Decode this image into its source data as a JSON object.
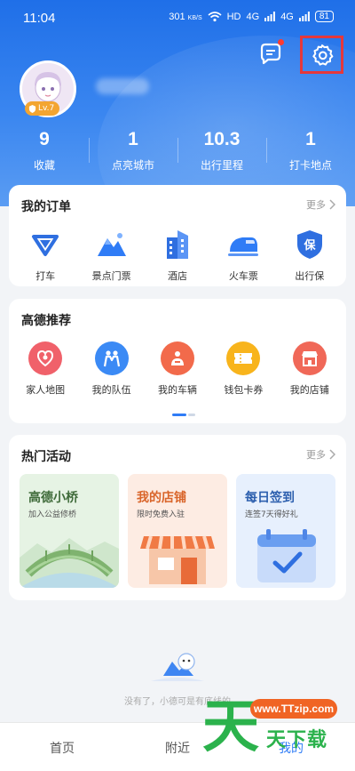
{
  "status_bar": {
    "time": "11:04",
    "net_speed": "301",
    "net_unit": "KB/S",
    "hd": "HD",
    "signal_1": "4G",
    "signal_2": "4G",
    "battery": "81"
  },
  "profile": {
    "level": "Lv.7"
  },
  "stats": [
    {
      "value": "9",
      "label": "收藏"
    },
    {
      "value": "1",
      "label": "点亮城市"
    },
    {
      "value": "10.3",
      "label": "出行里程"
    },
    {
      "value": "1",
      "label": "打卡地点"
    }
  ],
  "orders": {
    "title": "我的订单",
    "more": "更多",
    "items": [
      {
        "label": "打车",
        "icon": "taxi-icon"
      },
      {
        "label": "景点门票",
        "icon": "mountain-icon"
      },
      {
        "label": "酒店",
        "icon": "hotel-icon"
      },
      {
        "label": "火车票",
        "icon": "train-icon"
      },
      {
        "label": "出行保",
        "icon": "insurance-icon"
      }
    ]
  },
  "recommend": {
    "title": "高德推荐",
    "items": [
      {
        "label": "家人地图",
        "icon": "family-map-icon",
        "color": "#f0616a"
      },
      {
        "label": "我的队伍",
        "icon": "team-icon",
        "color": "#3b8af5"
      },
      {
        "label": "我的车辆",
        "icon": "vehicle-icon",
        "color": "#f26a4b"
      },
      {
        "label": "钱包卡券",
        "icon": "coupon-icon",
        "color": "#f8b41c"
      },
      {
        "label": "我的店铺",
        "icon": "store-icon",
        "color": "#f06858"
      }
    ]
  },
  "activities": {
    "title": "热门活动",
    "more": "更多",
    "items": [
      {
        "title": "高德小桥",
        "subtitle": "加入公益修桥",
        "color": "#e6f3e4",
        "title_color": "#3f6b3a"
      },
      {
        "title": "我的店铺",
        "subtitle": "限时免费入驻",
        "color": "#fdece3",
        "title_color": "#d9652a"
      },
      {
        "title": "每日签到",
        "subtitle": "连签7天得好礼",
        "color": "#e7f0fd",
        "title_color": "#2c5fae"
      }
    ]
  },
  "empty_state": {
    "text": "没有了，小德可是有底线的"
  },
  "watermark": {
    "url": "www.TTzip.com",
    "big": "天",
    "small": "天下载"
  },
  "bottom_nav": {
    "home": "首页",
    "nearby": "附近",
    "mine": "我的"
  },
  "colors": {
    "header_blue": "#1f6fe8",
    "highlight_red": "#e5383b",
    "accent_blue": "#2f7cf6"
  }
}
